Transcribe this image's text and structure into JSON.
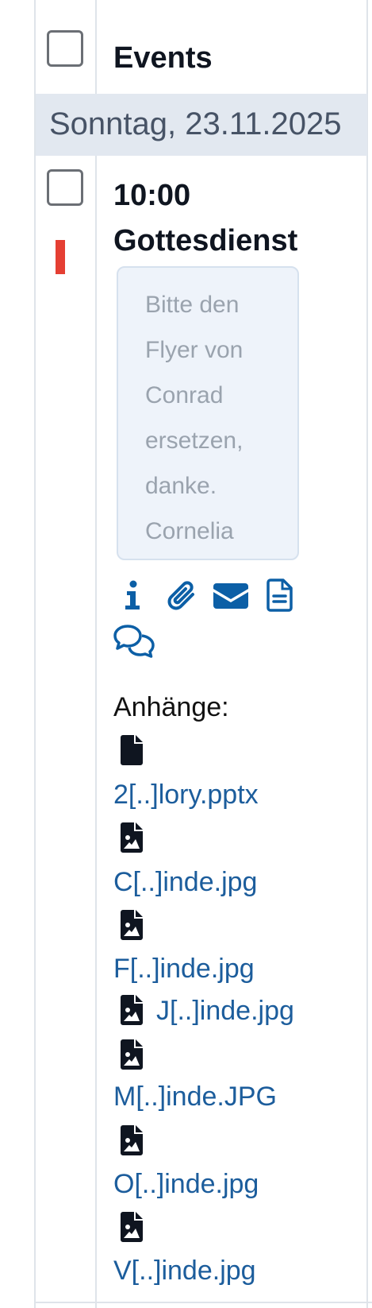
{
  "header": {
    "column_title": "Events"
  },
  "date_group": {
    "label": "Sonntag, 23.11.2025"
  },
  "event": {
    "time": "10:00",
    "title": "Gottesdienst",
    "note_lines": [
      "Bitte den",
      "Flyer von",
      "Conrad",
      "ersetzen,",
      "danke.",
      "Cornelia"
    ]
  },
  "action_icons": [
    "info-icon",
    "paperclip-icon",
    "envelope-icon",
    "document-icon",
    "comments-icon"
  ],
  "attachments": {
    "label": "Anhänge:",
    "files": [
      {
        "name": "2[..]lory.pptx",
        "icon": "file-icon"
      },
      {
        "name": "C[..]inde.jpg",
        "icon": "file-image-icon"
      },
      {
        "name": "F[..]inde.jpg",
        "icon": "file-image-icon"
      },
      {
        "name": "J[..]inde.jpg",
        "icon": "file-image-icon"
      },
      {
        "name": "M[..]inde.JPG",
        "icon": "file-image-icon"
      },
      {
        "name": "O[..]inde.jpg",
        "icon": "file-image-icon"
      },
      {
        "name": "V[..]inde.jpg",
        "icon": "file-image-icon"
      }
    ]
  },
  "colors": {
    "link": "#1c5d9c",
    "icon": "#0c5fa6",
    "status_bar": "#e53f33",
    "date_band": "#e2e8f0"
  }
}
